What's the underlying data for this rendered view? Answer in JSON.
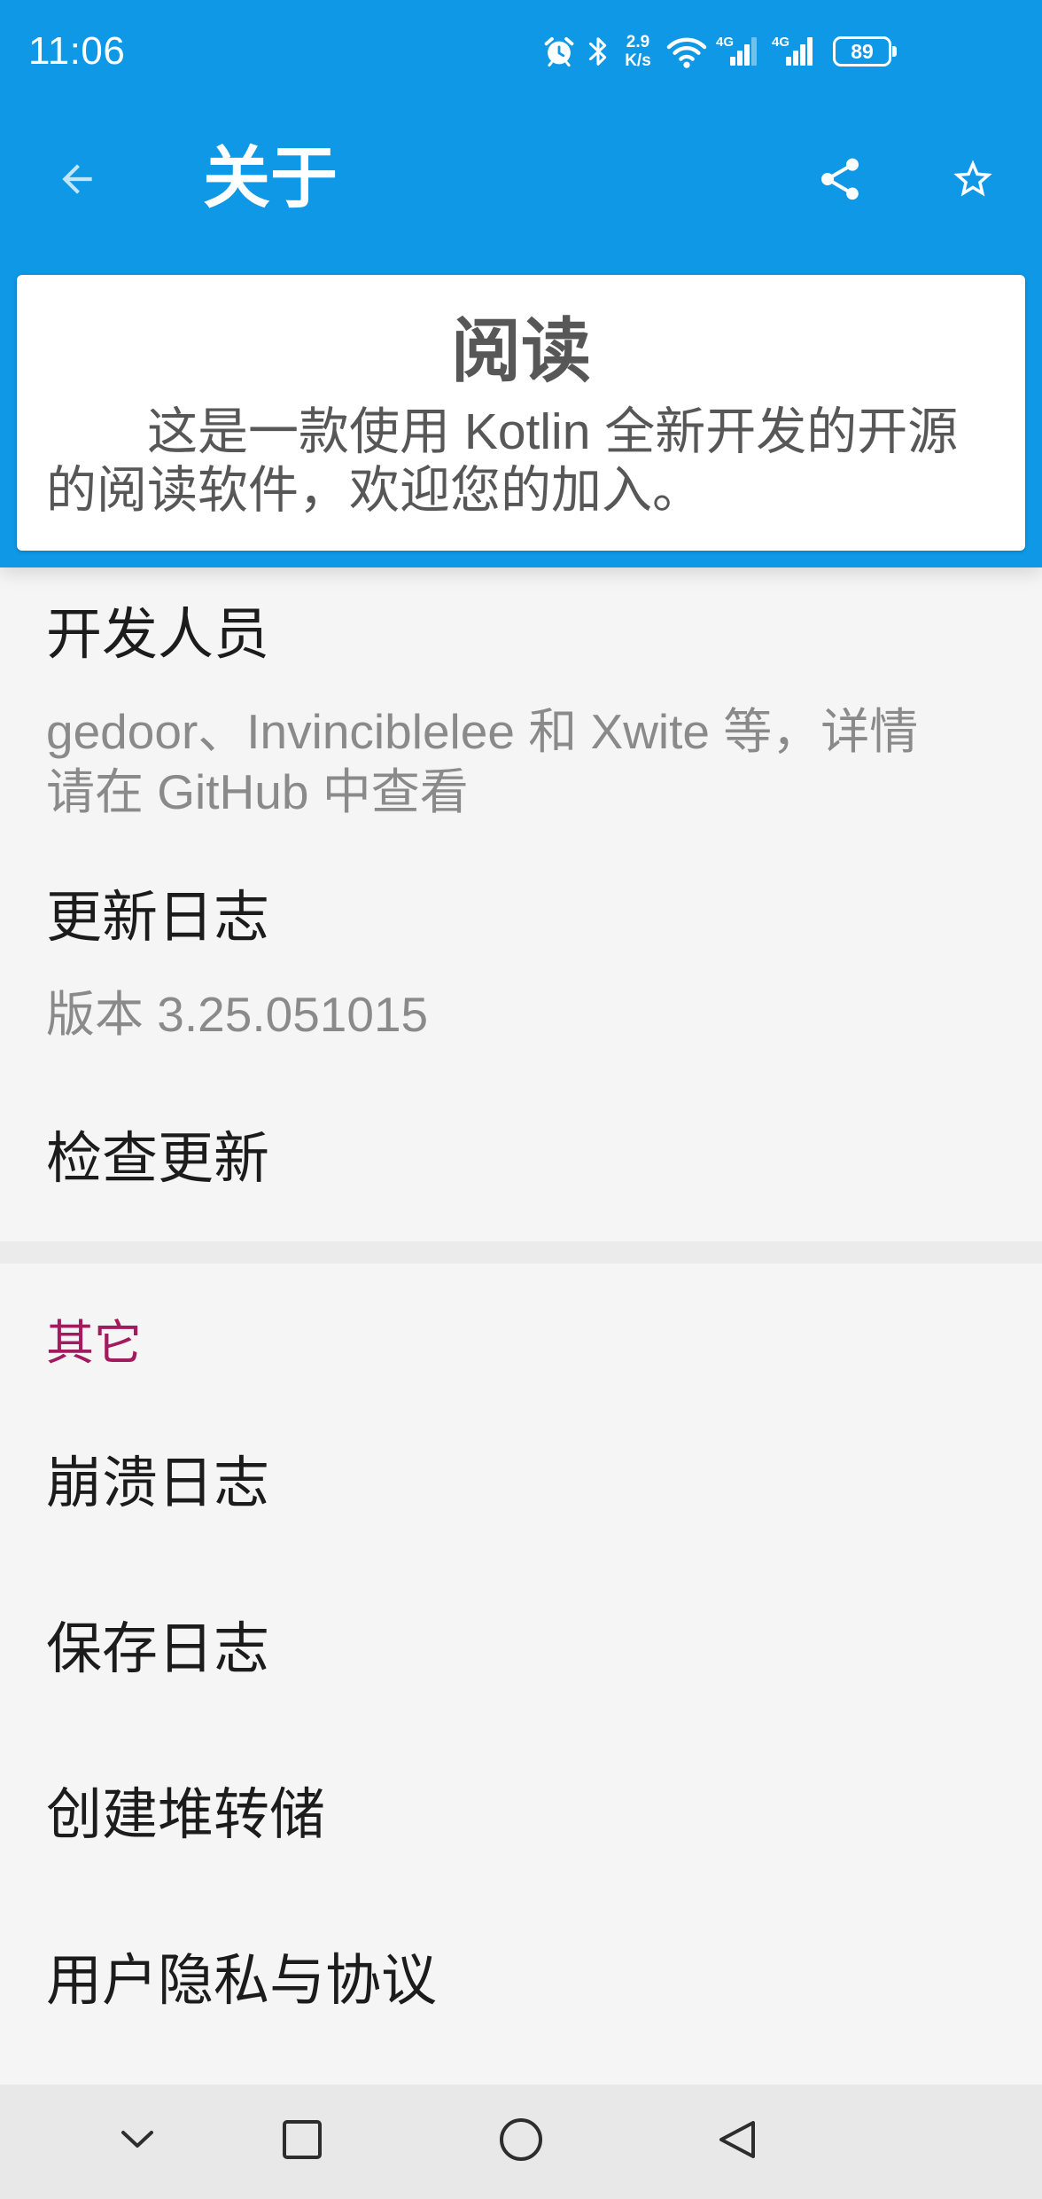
{
  "status_bar": {
    "time": "11:06",
    "net_speed": {
      "value": "2.9",
      "unit": "K/s"
    },
    "signals": [
      {
        "label": "4G",
        "level": 3
      },
      {
        "label": "4G",
        "level": 4
      }
    ],
    "battery_level": "89",
    "icons": [
      "alarm-clock-icon",
      "bluetooth-icon",
      "wifi-icon",
      "cellular-signal-icon",
      "battery-icon"
    ]
  },
  "app_bar": {
    "title": "关于",
    "navigation_icon": "arrow-back-icon",
    "action_icons": [
      "share-icon",
      "star-outline-icon"
    ]
  },
  "about_card": {
    "app_name": "阅读",
    "description": "这是一款使用 Kotlin 全新开发的开源的阅读软件，欢迎您的加入。"
  },
  "preferences": {
    "items": [
      {
        "title": "开发人员",
        "summary": "gedoor、Invinciblelee 和 Xwite 等，详情请在 GitHub 中查看"
      },
      {
        "title": "更新日志",
        "summary": "版本 3.25.051015"
      },
      {
        "title": "检查更新"
      }
    ],
    "other": {
      "category_title": "其它",
      "items": [
        {
          "title": "崩溃日志"
        },
        {
          "title": "保存日志"
        },
        {
          "title": "创建堆转储"
        },
        {
          "title": "用户隐私与协议"
        }
      ]
    }
  },
  "navigation_bar": {
    "icons": [
      "chevron-down-icon",
      "recents-square-icon",
      "home-circle-icon",
      "back-triangle-icon"
    ]
  },
  "colors": {
    "primary": "#0f98e6",
    "on_primary": "#ffffff",
    "accent_category": "#a21b5e",
    "background": "#f5f5f5",
    "card": "#ffffff",
    "card_text": "#575757",
    "title_text": "#1c1c1c",
    "summary_text": "#8a8a8a",
    "divider": "#ebebeb",
    "nav_bar": "#e8e8e8",
    "nav_icon": "#2d2d2d"
  }
}
